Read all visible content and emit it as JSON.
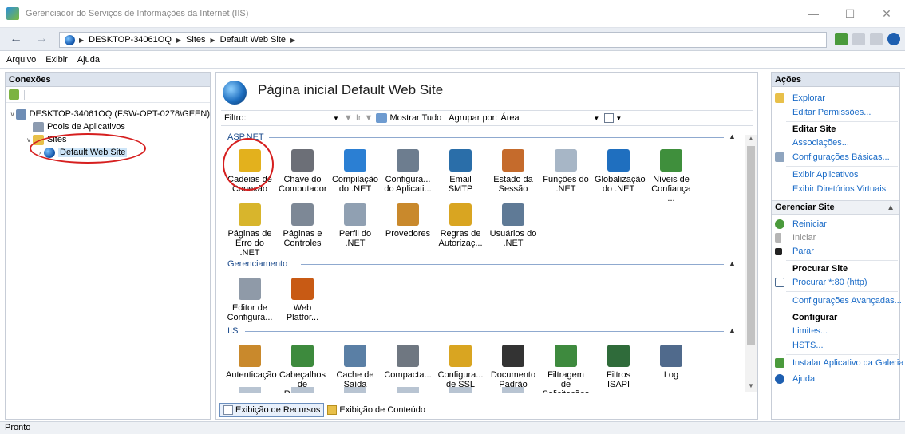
{
  "window": {
    "title": "Gerenciador do Serviços de Informações da Internet (IIS)"
  },
  "address": {
    "crumbs": [
      "DESKTOP-34061OQ",
      "Sites",
      "Default Web Site"
    ]
  },
  "menu": [
    "Arquivo",
    "Exibir",
    "Ajuda"
  ],
  "connections": {
    "title": "Conexões",
    "tree": [
      {
        "label": "DESKTOP-34061OQ (FSW-OPT-0278\\GEEN)",
        "indent": 0,
        "expander": "v"
      },
      {
        "label": "Pools de Aplicativos",
        "indent": 1,
        "expander": ""
      },
      {
        "label": "Sites",
        "indent": 1,
        "expander": "v"
      },
      {
        "label": "Default Web Site",
        "indent": 2,
        "expander": ">"
      }
    ]
  },
  "main": {
    "title": "Página inicial Default Web Site",
    "filter": {
      "label": "Filtro:",
      "go": "Ir",
      "show_all": "Mostrar Tudo",
      "group_by": "Agrupar por:",
      "group_value": "Área"
    },
    "sections": [
      {
        "name": "ASP.NET",
        "features": [
          {
            "label": "Cadeias de Conexão",
            "color": "#e3b11d"
          },
          {
            "label": "Chave do Computador",
            "color": "#6c6f77"
          },
          {
            "label": "Compilação do .NET",
            "color": "#2b7fd3"
          },
          {
            "label": "Configura... do Aplicati...",
            "color": "#6d7d8f"
          },
          {
            "label": "Email SMTP",
            "color": "#2a6ea9"
          },
          {
            "label": "Estado da Sessão",
            "color": "#c56b2c"
          },
          {
            "label": "Funções do .NET",
            "color": "#a7b6c6"
          },
          {
            "label": "Globalização do .NET",
            "color": "#1f6fbf"
          },
          {
            "label": "Níveis de Confiança ...",
            "color": "#3f8f3c"
          },
          {
            "label": "Páginas de Erro do .NET",
            "color": "#d8b52c"
          },
          {
            "label": "Páginas e Controles",
            "color": "#7d8896"
          },
          {
            "label": "Perfil do .NET",
            "color": "#90a0b2"
          },
          {
            "label": "Provedores",
            "color": "#c9892c"
          },
          {
            "label": "Regras de Autorizaç...",
            "color": "#d9a521"
          },
          {
            "label": "Usuários do .NET",
            "color": "#5f7a96"
          }
        ]
      },
      {
        "name": "Gerenciamento",
        "features": [
          {
            "label": "Editor de Configura...",
            "color": "#8f9aa8"
          },
          {
            "label": "Web Platfor...",
            "color": "#c85a14"
          }
        ]
      },
      {
        "name": "IIS",
        "features": [
          {
            "label": "Autenticação",
            "color": "#c9892c"
          },
          {
            "label": "Cabeçalhos de Respos...",
            "color": "#3d8a3d"
          },
          {
            "label": "Cache de Saída",
            "color": "#5a7fa5"
          },
          {
            "label": "Compacta...",
            "color": "#6f7781"
          },
          {
            "label": "Configura... de SSL",
            "color": "#d9a521"
          },
          {
            "label": "Documento Padrão",
            "color": "#333333"
          },
          {
            "label": "Filtragem de Solicitações",
            "color": "#3e8a3e"
          },
          {
            "label": "Filtros ISAPI",
            "color": "#2f6b3a"
          },
          {
            "label": "Log",
            "color": "#506a8c"
          }
        ]
      }
    ],
    "view_tabs": [
      "Exibição de Recursos",
      "Exibição de Conteúdo"
    ]
  },
  "actions": {
    "title": "Ações",
    "explorar": "Explorar",
    "editar_permissoes": "Editar Permissões...",
    "editar_site": "Editar Site",
    "associacoes": "Associações...",
    "config_basicas": "Configurações Básicas...",
    "exibir_aplicativos": "Exibir Aplicativos",
    "exibir_diretorios": "Exibir Diretórios Virtuais",
    "gerenciar_site": "Gerenciar Site",
    "reiniciar": "Reiniciar",
    "iniciar": "Iniciar",
    "parar": "Parar",
    "procurar_site": "Procurar Site",
    "procurar_80": "Procurar *:80 (http)",
    "config_avancadas": "Configurações Avançadas...",
    "configurar": "Configurar",
    "limites": "Limites...",
    "hsts": "HSTS...",
    "instalar_galeria": "Instalar Aplicativo da Galeria",
    "ajuda": "Ajuda"
  },
  "status": {
    "text": "Pronto"
  }
}
